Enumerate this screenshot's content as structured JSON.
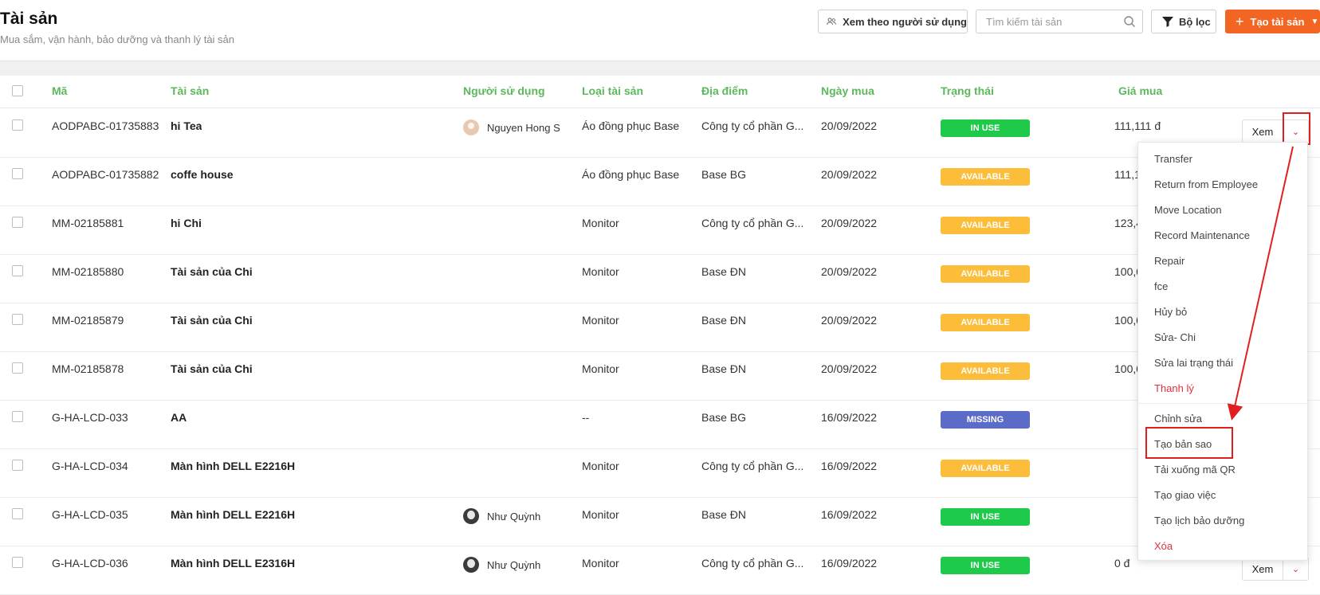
{
  "header": {
    "title": "Tài sản",
    "subtitle": "Mua sắm, vận hành, bảo dưỡng và thanh lý tài sản",
    "view_by_user_label": "Xem theo người sử dụng",
    "search_placeholder": "Tìm kiếm tài sản",
    "filter_label": "Bộ lọc",
    "create_label": "Tạo tài sản"
  },
  "table": {
    "columns": [
      "Mã",
      "Tài sản",
      "Người sử dụng",
      "Loại tài sản",
      "Địa điểm",
      "Ngày mua",
      "Trạng thái",
      "Giá mua"
    ],
    "view_button_label": "Xem",
    "rows": [
      {
        "code": "AODPABC-01735883",
        "asset": "hi Tea",
        "user": "Nguyen Hong S",
        "avatar": "light",
        "type": "Áo đồng phục Base",
        "location": "Công ty cổ phần G...",
        "date": "20/09/2022",
        "status": "IN USE",
        "price": "111,111 đ"
      },
      {
        "code": "AODPABC-01735882",
        "asset": "coffe house",
        "user": "",
        "avatar": "",
        "type": "Áo đồng phục Base",
        "location": "Base BG",
        "date": "20/09/2022",
        "status": "AVAILABLE",
        "price": "111,1"
      },
      {
        "code": "MM-02185881",
        "asset": "hi Chi",
        "user": "",
        "avatar": "",
        "type": "Monitor",
        "location": "Công ty cổ phần G...",
        "date": "20/09/2022",
        "status": "AVAILABLE",
        "price": "123,4"
      },
      {
        "code": "MM-02185880",
        "asset": "Tài sản của Chi",
        "user": "",
        "avatar": "",
        "type": "Monitor",
        "location": "Base ĐN",
        "date": "20/09/2022",
        "status": "AVAILABLE",
        "price": "100,0"
      },
      {
        "code": "MM-02185879",
        "asset": "Tài sản của Chi",
        "user": "",
        "avatar": "",
        "type": "Monitor",
        "location": "Base ĐN",
        "date": "20/09/2022",
        "status": "AVAILABLE",
        "price": "100,0"
      },
      {
        "code": "MM-02185878",
        "asset": "Tài sản của Chi",
        "user": "",
        "avatar": "",
        "type": "Monitor",
        "location": "Base ĐN",
        "date": "20/09/2022",
        "status": "AVAILABLE",
        "price": "100,0"
      },
      {
        "code": "G-HA-LCD-033",
        "asset": "AA",
        "user": "",
        "avatar": "",
        "type": "--",
        "location": "Base BG",
        "date": "16/09/2022",
        "status": "MISSING",
        "price": ""
      },
      {
        "code": "G-HA-LCD-034",
        "asset": "Màn hình DELL E2216H",
        "user": "",
        "avatar": "",
        "type": "Monitor",
        "location": "Công ty cổ phần G...",
        "date": "16/09/2022",
        "status": "AVAILABLE",
        "price": ""
      },
      {
        "code": "G-HA-LCD-035",
        "asset": "Màn hình DELL E2216H",
        "user": "Như Quỳnh",
        "avatar": "dark",
        "type": "Monitor",
        "location": "Base ĐN",
        "date": "16/09/2022",
        "status": "IN USE",
        "price": ""
      },
      {
        "code": "G-HA-LCD-036",
        "asset": "Màn hình DELL E2316H",
        "user": "Như Quỳnh",
        "avatar": "dark",
        "type": "Monitor",
        "location": "Công ty cổ phần G...",
        "date": "16/09/2022",
        "status": "IN USE",
        "price": "0 đ"
      }
    ]
  },
  "status_colors": {
    "IN USE": "#1fc94a",
    "AVAILABLE": "#fbbd3a",
    "MISSING": "#5b6bc8"
  },
  "dropdown": {
    "group1": [
      {
        "label": "Transfer",
        "danger": false
      },
      {
        "label": "Return from Employee",
        "danger": false
      },
      {
        "label": "Move Location",
        "danger": false
      },
      {
        "label": "Record Maintenance",
        "danger": false
      },
      {
        "label": "Repair",
        "danger": false
      },
      {
        "label": "fce",
        "danger": false
      },
      {
        "label": "Hủy bỏ",
        "danger": false
      },
      {
        "label": "Sửa- Chi",
        "danger": false
      },
      {
        "label": "Sửa lai trạng thái",
        "danger": false
      },
      {
        "label": "Thanh lý",
        "danger": true
      }
    ],
    "group2": [
      {
        "label": "Chỉnh sửa",
        "danger": false
      },
      {
        "label": "Tạo bản sao",
        "danger": false
      },
      {
        "label": "Tải xuống mã QR",
        "danger": false
      },
      {
        "label": "Tạo giao việc",
        "danger": false
      },
      {
        "label": "Tạo lịch bảo dưỡng",
        "danger": false
      },
      {
        "label": "Xóa",
        "danger": true
      }
    ]
  },
  "accent_color": "#f26522"
}
